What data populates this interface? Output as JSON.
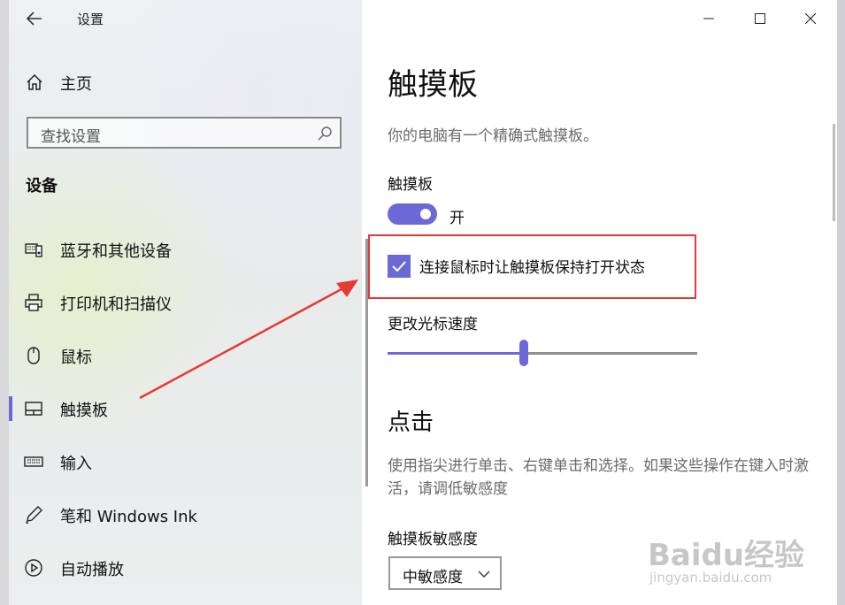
{
  "window": {
    "app_title": "设置",
    "controls": {
      "minimize": "minimize-icon",
      "maximize": "maximize-icon",
      "close": "close-icon"
    }
  },
  "sidebar": {
    "home_label": "主页",
    "search_placeholder": "查找设置",
    "section_title": "设备",
    "items": [
      {
        "label": "蓝牙和其他设备",
        "icon": "bluetooth-devices-icon"
      },
      {
        "label": "打印机和扫描仪",
        "icon": "printer-icon"
      },
      {
        "label": "鼠标",
        "icon": "mouse-icon"
      },
      {
        "label": "触摸板",
        "icon": "touchpad-icon",
        "active": true
      },
      {
        "label": "输入",
        "icon": "keyboard-icon"
      },
      {
        "label": "笔和 Windows Ink",
        "icon": "pen-icon"
      },
      {
        "label": "自动播放",
        "icon": "autoplay-icon"
      }
    ]
  },
  "main": {
    "title": "触摸板",
    "description": "你的电脑有一个精确式触摸板。",
    "touchpad_label": "触摸板",
    "toggle_state_label": "开",
    "toggle_on": true,
    "keep_on_checkbox_label": "连接鼠标时让触摸板保持打开状态",
    "keep_on_checked": true,
    "cursor_speed_label": "更改光标速度",
    "cursor_speed_fraction": 0.44,
    "tap_heading": "点击",
    "tap_description": "使用指尖进行单击、右键单击和选择。如果这些操作在键入时激活，请调低敏感度",
    "sensitivity_label": "触摸板敏感度",
    "sensitivity_value": "中敏感度"
  },
  "watermark": {
    "logo": "Baidu经验",
    "url": "jingyan.baidu.com"
  },
  "colors": {
    "accent": "#6b69d6",
    "annotation": "#e53935"
  }
}
